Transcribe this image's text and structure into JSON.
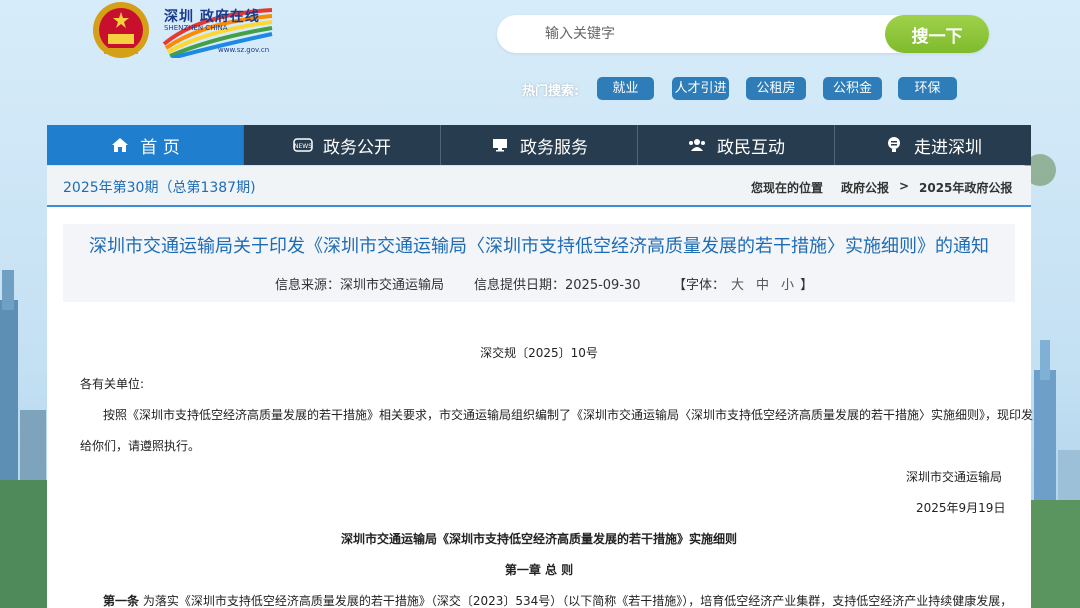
{
  "site": {
    "logo_text": "深圳 政府在线",
    "logo_en": "SHENZHEN CHINA",
    "logo_url": "www.sz.gov.cn"
  },
  "search": {
    "placeholder": "输入关键字",
    "button_label": "搜一下"
  },
  "hot_search": {
    "label": "热门搜索:",
    "tags": [
      "就业",
      "人才引进",
      "公租房",
      "公积金",
      "环保"
    ]
  },
  "nav": {
    "items": [
      {
        "label": "首 页",
        "icon": "home-icon"
      },
      {
        "label": "政务公开",
        "icon": "news-icon"
      },
      {
        "label": "政务服务",
        "icon": "monitor-icon"
      },
      {
        "label": "政民互动",
        "icon": "people-icon"
      },
      {
        "label": "走进深圳",
        "icon": "pin-icon"
      }
    ]
  },
  "issue": {
    "text": "2025年第30期（总第1387期)"
  },
  "breadcrumb": {
    "prefix": "您现在的位置",
    "item1": "政府公报",
    "sep": ">",
    "item2": "2025年政府公报"
  },
  "doc": {
    "title": "深圳市交通运输局关于印发《深圳市交通运输局〈深圳市支持低空经济高质量发展的若干措施〉实施细则》的通知",
    "source": "信息来源：深圳市交通运输局",
    "date": "信息提供日期：2025-09-30",
    "font_label_open": "【字体：",
    "font_large": "大",
    "font_medium": "中",
    "font_small": "小",
    "font_label_close": "】",
    "doc_no": "深交规〔2025〕10号",
    "salutation": "各有关单位:",
    "body_1": "按照《深圳市支持低空经济高质量发展的若干措施》相关要求，市交通运输局组织编制了《深圳市交通运输局〈深圳市支持低空经济高质量发展的若干措施〉实施细则》，现印发",
    "body_2": "给你们，请遵照执行。",
    "signature": "深圳市交通运输局",
    "sign_date": "2025年9月19日",
    "sub_title": "深圳市交通运输局《深圳市支持低空经济高质量发展的若干措施》实施细则",
    "chapter": "第一章 总 则",
    "art1_label": "第一条",
    "art1_text": "为落实《深圳市支持低空经济高质量发展的若干措施》（深交〔2023〕534号）（以下简称《若干措施》），培育低空经济产业集群，支持低空经济产业持续健康发展，"
  },
  "colors": {
    "nav_bg": "#273c4f",
    "nav_active": "#1f7fce",
    "accent_blue": "#1e6cb5",
    "search_green": "#8cc63f",
    "tag_blue": "#2f7db8"
  }
}
